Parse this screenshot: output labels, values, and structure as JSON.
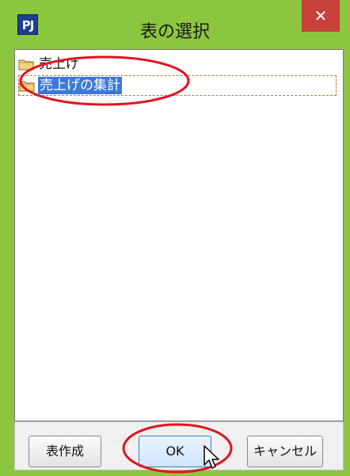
{
  "window": {
    "title": "表の選択",
    "app_icon_text": "PJ",
    "close_symbol": "✕"
  },
  "list": {
    "items": [
      {
        "label": "売上げ",
        "selected": false,
        "icon": "folder-icon"
      },
      {
        "label": "売上げの集計",
        "selected": true,
        "icon": "folder-icon"
      }
    ]
  },
  "buttons": {
    "create_label": "表作成",
    "ok_label": "OK",
    "cancel_label": "キャンセル"
  },
  "colors": {
    "frame": "#8cc63e",
    "close_button": "#c7403a",
    "selection": "#3b78d8",
    "annotation": "#e0141e"
  }
}
